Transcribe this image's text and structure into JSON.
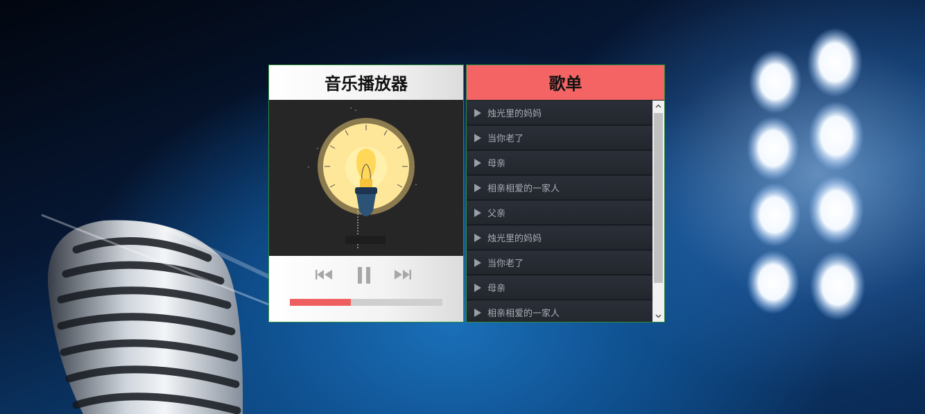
{
  "player": {
    "title": "音乐播放器",
    "cover_icon": "lightbulb-illustration",
    "controls": {
      "prev_icon": "skip-previous-icon",
      "pause_icon": "pause-icon",
      "next_icon": "skip-next-icon"
    },
    "progress_fraction": 0.4,
    "colors": {
      "progress": "#f05f60",
      "track": "#cfcfcf"
    }
  },
  "playlist": {
    "title": "歌单",
    "header_color": "#f46464",
    "items": [
      {
        "label": "烛光里的妈妈"
      },
      {
        "label": "当你老了"
      },
      {
        "label": "母亲"
      },
      {
        "label": "相亲相爱的一家人"
      },
      {
        "label": "父亲"
      },
      {
        "label": "烛光里的妈妈"
      },
      {
        "label": "当你老了"
      },
      {
        "label": "母亲"
      },
      {
        "label": "相亲相爱的一家人"
      }
    ]
  }
}
